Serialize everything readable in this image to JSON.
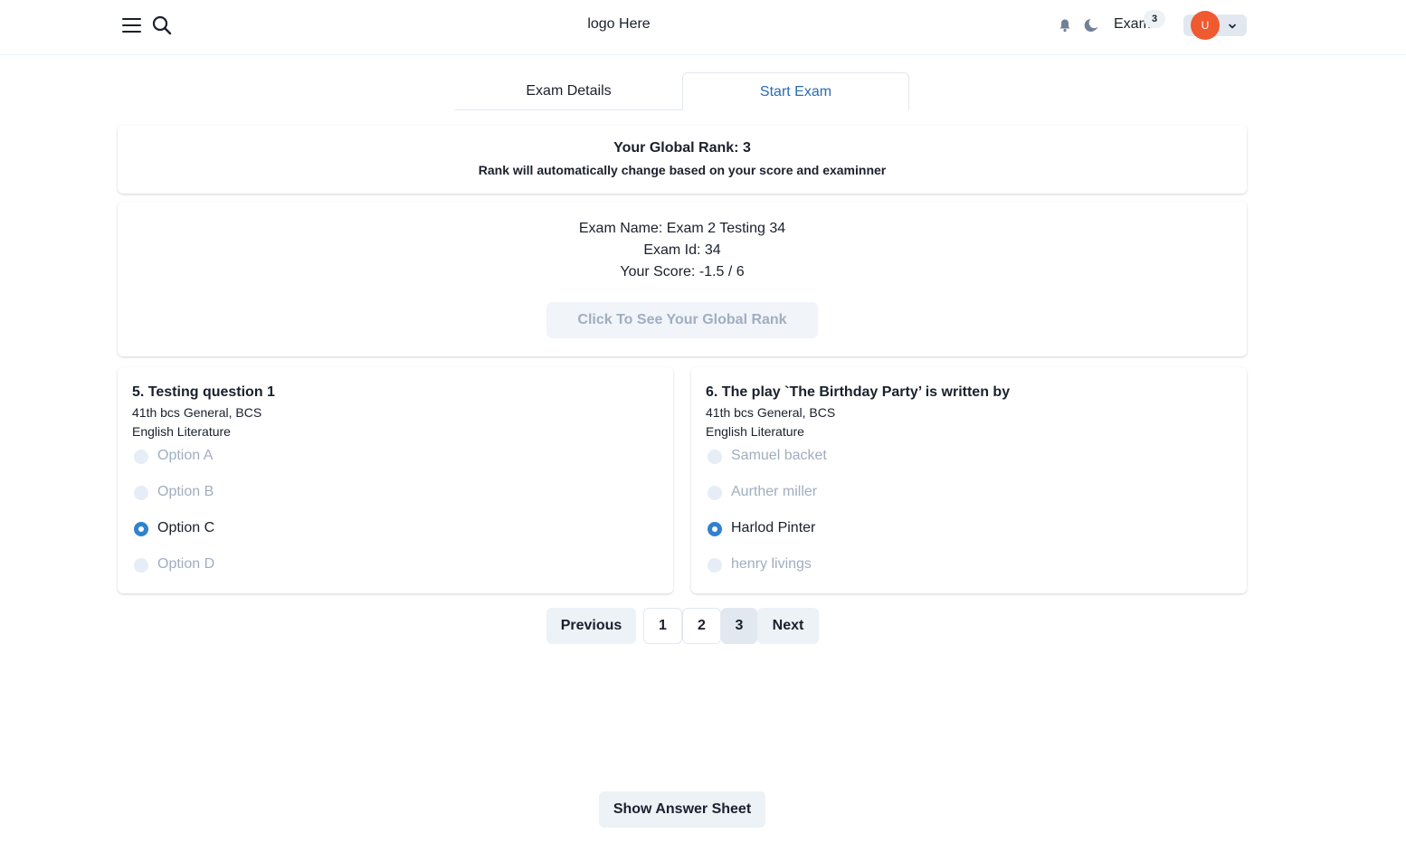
{
  "header": {
    "logo_text": "logo Here",
    "exam_link": "Exam",
    "exam_badge": "3",
    "avatar_initial": "U"
  },
  "tabs": [
    {
      "label": "Exam Details",
      "active": false
    },
    {
      "label": "Start Exam",
      "active": true
    }
  ],
  "rank": {
    "title": "Your Global Rank: 3",
    "subtitle": "Rank will automatically change based on your score and examinner"
  },
  "exam_info": {
    "name_line": "Exam Name: Exam 2 Testing 34",
    "id_line": "Exam Id: 34",
    "score_line": "Your Score: -1.5 / 6",
    "global_rank_button": "Click To See Your Global Rank"
  },
  "questions": [
    {
      "title": "5. Testing question 1",
      "meta1": "41th bcs General, BCS",
      "meta2": "English Literature",
      "options": [
        "Option A",
        "Option B",
        "Option C",
        "Option D"
      ],
      "selected_index": 2
    },
    {
      "title": "6. The play `The Birthday Party’ is written by",
      "meta1": "41th bcs General, BCS",
      "meta2": "English Literature",
      "options": [
        "Samuel backet",
        "Aurther miller",
        "Harlod Pinter",
        "henry livings"
      ],
      "selected_index": 2
    }
  ],
  "pagination": {
    "previous": "Previous",
    "pages": [
      "1",
      "2",
      "3"
    ],
    "current_page": "3",
    "next": "Next"
  },
  "answer_sheet_button": "Show Answer Sheet",
  "colors": {
    "accent": "#3182ce",
    "tab_active": "#2b6cb0",
    "avatar": "#ef5a31",
    "muted_text": "#a0aec0"
  }
}
